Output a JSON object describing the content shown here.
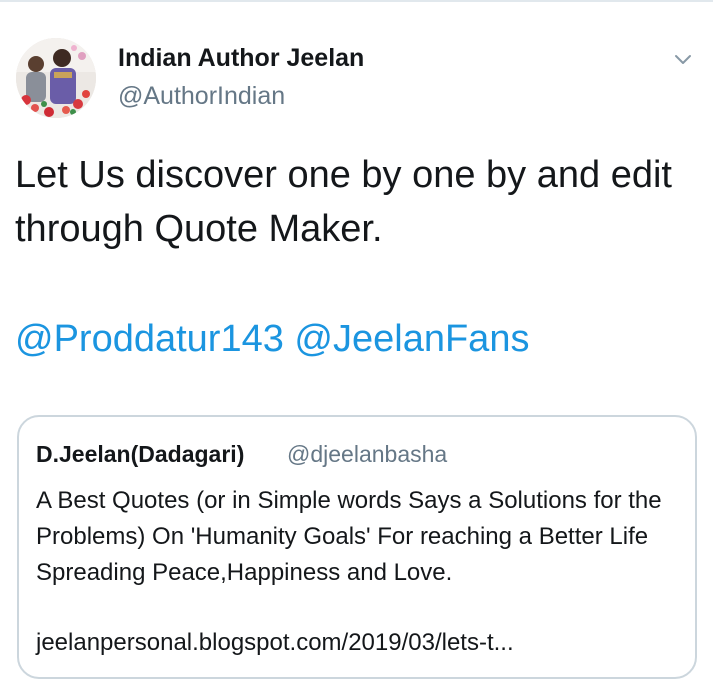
{
  "tweet": {
    "author_name": "Indian Author Jeelan",
    "author_handle": "@AuthorIndian",
    "text": "Let Us discover one by one by and edit through Quote Maker.",
    "mentions": [
      "@Proddatur143",
      "@JeelanFans"
    ],
    "menu_icon": "chevron-down-icon"
  },
  "quoted": {
    "author_name": "D.Jeelan(Dadagari)",
    "author_handle": "@djeelanbasha",
    "text": "A Best Quotes (or in Simple words Says a Solutions for the Problems) On 'Humanity Goals' For reaching a Better Life Spreading Peace,Happiness and Love.",
    "link": "jeelanpersonal.blogspot.com/2019/03/lets-t..."
  },
  "colors": {
    "link": "#1b95e0",
    "secondary_text": "#657786",
    "border": "#ccd6dd"
  }
}
